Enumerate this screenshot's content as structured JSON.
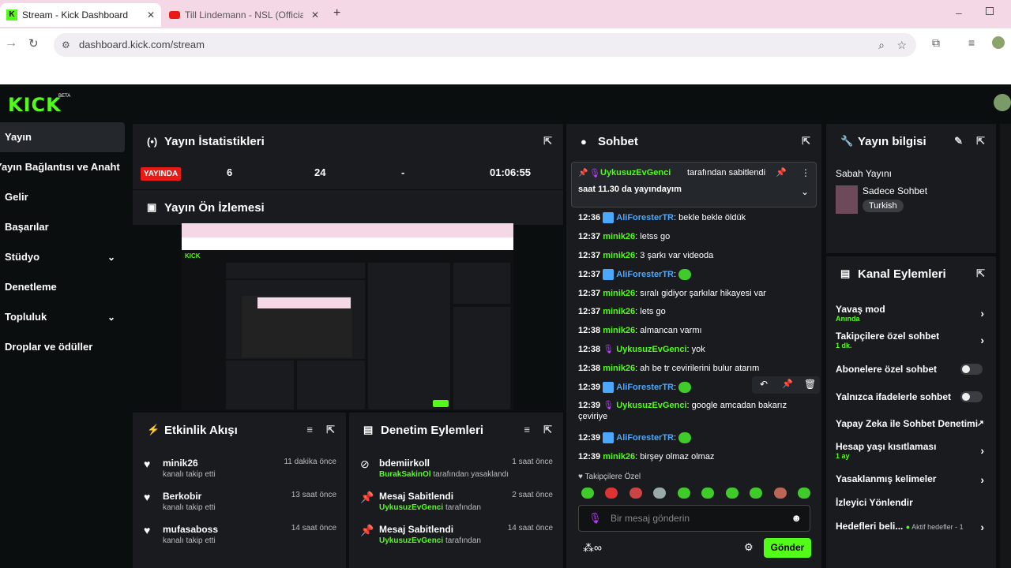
{
  "browser": {
    "tabs": [
      {
        "title": "Stream - Kick Dashboard"
      },
      {
        "title": "Till Lindemann - NSL (Official Vi"
      }
    ],
    "url": "dashboard.kick.com/stream"
  },
  "brand": {
    "logo": "KICK",
    "beta": "BETA"
  },
  "sidebar": {
    "items": [
      {
        "label": "Yayın"
      },
      {
        "label": "Yayın Bağlantısı ve Anahtarı"
      },
      {
        "label": "Gelir"
      },
      {
        "label": "Başarılar"
      },
      {
        "label": "Stüdyo"
      },
      {
        "label": "Denetleme"
      },
      {
        "label": "Topluluk"
      },
      {
        "label": "Droplar ve ödüller"
      }
    ]
  },
  "stats": {
    "title": "Yayın İstatistikleri",
    "status": "YAYINDA",
    "v1": "6",
    "v2": "24",
    "v3": "-",
    "duration": "01:06:55"
  },
  "preview": {
    "title": "Yayın Ön İzlemesi"
  },
  "activity": {
    "title": "Etkinlik Akışı",
    "items": [
      {
        "name": "minik26",
        "sub": "kanalı takip etti",
        "time": "11 dakika önce"
      },
      {
        "name": "Berkobir",
        "sub": "kanalı takip etti",
        "time": "13 saat önce"
      },
      {
        "name": "mufasaboss",
        "sub": "kanalı takip etti",
        "time": "14 saat önce"
      }
    ]
  },
  "mod": {
    "title": "Denetim Eylemleri",
    "items": [
      {
        "name": "bdemiirkoll",
        "user": "BurakSakinOl",
        "suffix": "tarafından yasaklandı",
        "time": "1 saat önce"
      },
      {
        "name": "Mesaj Sabitlendi",
        "user": "UykusuzEvGenci",
        "suffix": "tarafından",
        "time": "2 saat önce"
      },
      {
        "name": "Mesaj Sabitlendi",
        "user": "UykusuzEvGenci",
        "suffix": "tarafından",
        "time": "14 saat önce"
      }
    ]
  },
  "chat": {
    "title": "Sohbet",
    "pinned_by": "UykusuzEvGenci",
    "pinned_suffix": "tarafından sabitlendi",
    "pinned_text": "saat 11.30 da yayındayım",
    "messages": [
      {
        "time": "12:36",
        "user": "AliForesterTR",
        "text": "bekle bekle öldük"
      },
      {
        "time": "12:37",
        "user": "minik26",
        "text": "letss go"
      },
      {
        "time": "12:37",
        "user": "minik26",
        "text": "3 şarkı var videoda"
      },
      {
        "time": "12:37",
        "user": "AliForesterTR",
        "text": ""
      },
      {
        "time": "12:37",
        "user": "minik26",
        "text": "sıralı gidiyor şarkılar hikayesi var"
      },
      {
        "time": "12:37",
        "user": "minik26",
        "text": "lets go"
      },
      {
        "time": "12:38",
        "user": "minik26",
        "text": "almancan varmı"
      },
      {
        "time": "12:38",
        "user": "UykusuzEvGenci",
        "text": "yok"
      },
      {
        "time": "12:38",
        "user": "minik26",
        "text": "ah be tr cevirilerini bulur atarım"
      },
      {
        "time": "12:39",
        "user": "AliForesterTR",
        "text": ""
      },
      {
        "time": "12:39",
        "user": "UykusuzEvGenci",
        "text": "google amcadan bakarız çeviriye"
      },
      {
        "time": "12:39",
        "user": "AliForesterTR",
        "text": ""
      },
      {
        "time": "12:39",
        "user": "minik26",
        "text": "birşey olmaz olmaz"
      }
    ],
    "followers_only": "Takipçilere Özel",
    "placeholder": "Bir mesaj gönderin",
    "send": "Gönder"
  },
  "info": {
    "title": "Yayın bilgisi",
    "stream_title": "Sabah Yayını",
    "category": "Sadece Sohbet",
    "language": "Turkish"
  },
  "channel": {
    "title": "Kanal Eylemleri",
    "items": [
      {
        "label": "Yavaş mod",
        "sub": "Anında"
      },
      {
        "label": "Takipçilere özel sohbet",
        "sub": "1 dk."
      },
      {
        "label": "Abonelere özel sohbet",
        "sub": ""
      },
      {
        "label": "Yalnızca ifadelerle sohbet",
        "sub": ""
      },
      {
        "label": "Yapay Zeka ile Sohbet Denetimi",
        "sub": ""
      },
      {
        "label": "Hesap yaşı kısıtlaması",
        "sub": "1 ay"
      },
      {
        "label": "Yasaklanmış kelimeler",
        "sub": ""
      },
      {
        "label": "İzleyici Yönlendir",
        "sub": ""
      },
      {
        "label": "Hedefleri beli...",
        "sub": "Aktif hedefler - 1"
      }
    ]
  },
  "colors": {
    "accent": "#53fc18",
    "live": "#e91916",
    "panel": "#191b1f",
    "chat_user_blue": "#4aa8ff"
  }
}
